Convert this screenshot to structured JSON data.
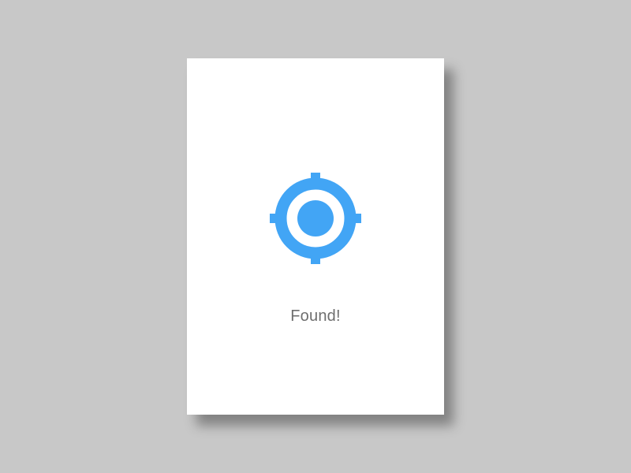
{
  "status": {
    "message": "Found!"
  },
  "icon": {
    "name": "location-target-icon",
    "color": "#42a5f5"
  },
  "colors": {
    "background": "#c8c8c8",
    "card": "#ffffff",
    "text": "#6e6e6e"
  }
}
